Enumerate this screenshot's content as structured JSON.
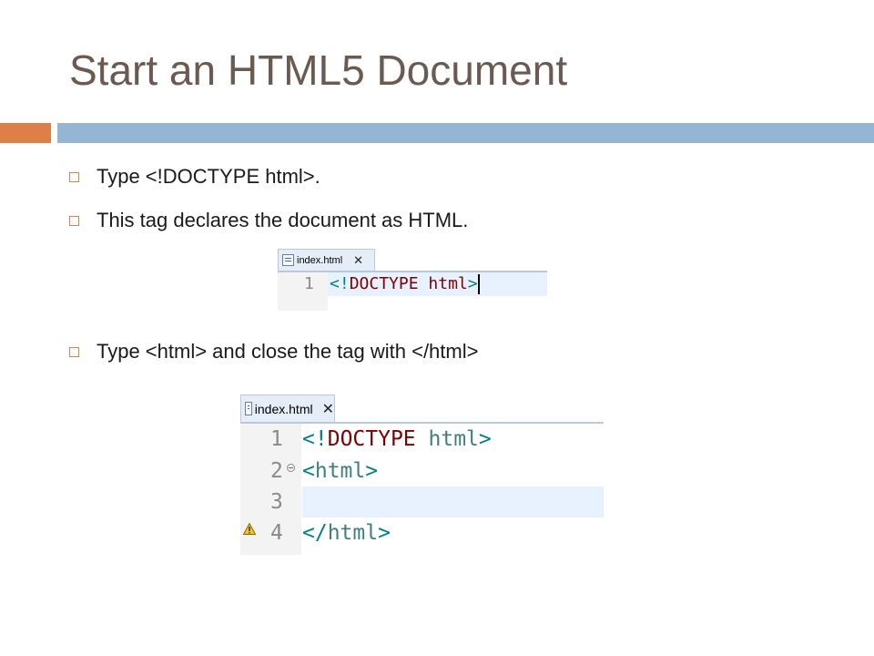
{
  "slide": {
    "title": "Start an HTML5 Document",
    "bullets": [
      "Type <!DOCTYPE html>.",
      "This tag declares the document as HTML.",
      "Type <html> and close the tag with </html>"
    ]
  },
  "editor1": {
    "tab_label": "index.html",
    "close_glyph": "✕",
    "line_number": "1",
    "code": {
      "open": "<",
      "bang": "!",
      "keyword": "DOCTYPE",
      "space": " ",
      "name": "html",
      "close": ">"
    }
  },
  "editor2": {
    "tab_label": "index.html",
    "close_glyph": "✕",
    "line_numbers": [
      "1",
      "2",
      "3",
      "4"
    ],
    "line1": {
      "open": "<",
      "bang": "!",
      "keyword": "DOCTYPE",
      "space": " ",
      "name": "html",
      "close": ">"
    },
    "line2": {
      "open": "<",
      "name": "html",
      "close": ">"
    },
    "line4": {
      "open": "</",
      "name": "html",
      "close": ">"
    }
  },
  "colors": {
    "title": "#6b5a50",
    "accent_orange": "#dd8047",
    "accent_blue": "#94b6d2",
    "code_keyword": "#800000",
    "code_tag": "#3f7f7f"
  }
}
